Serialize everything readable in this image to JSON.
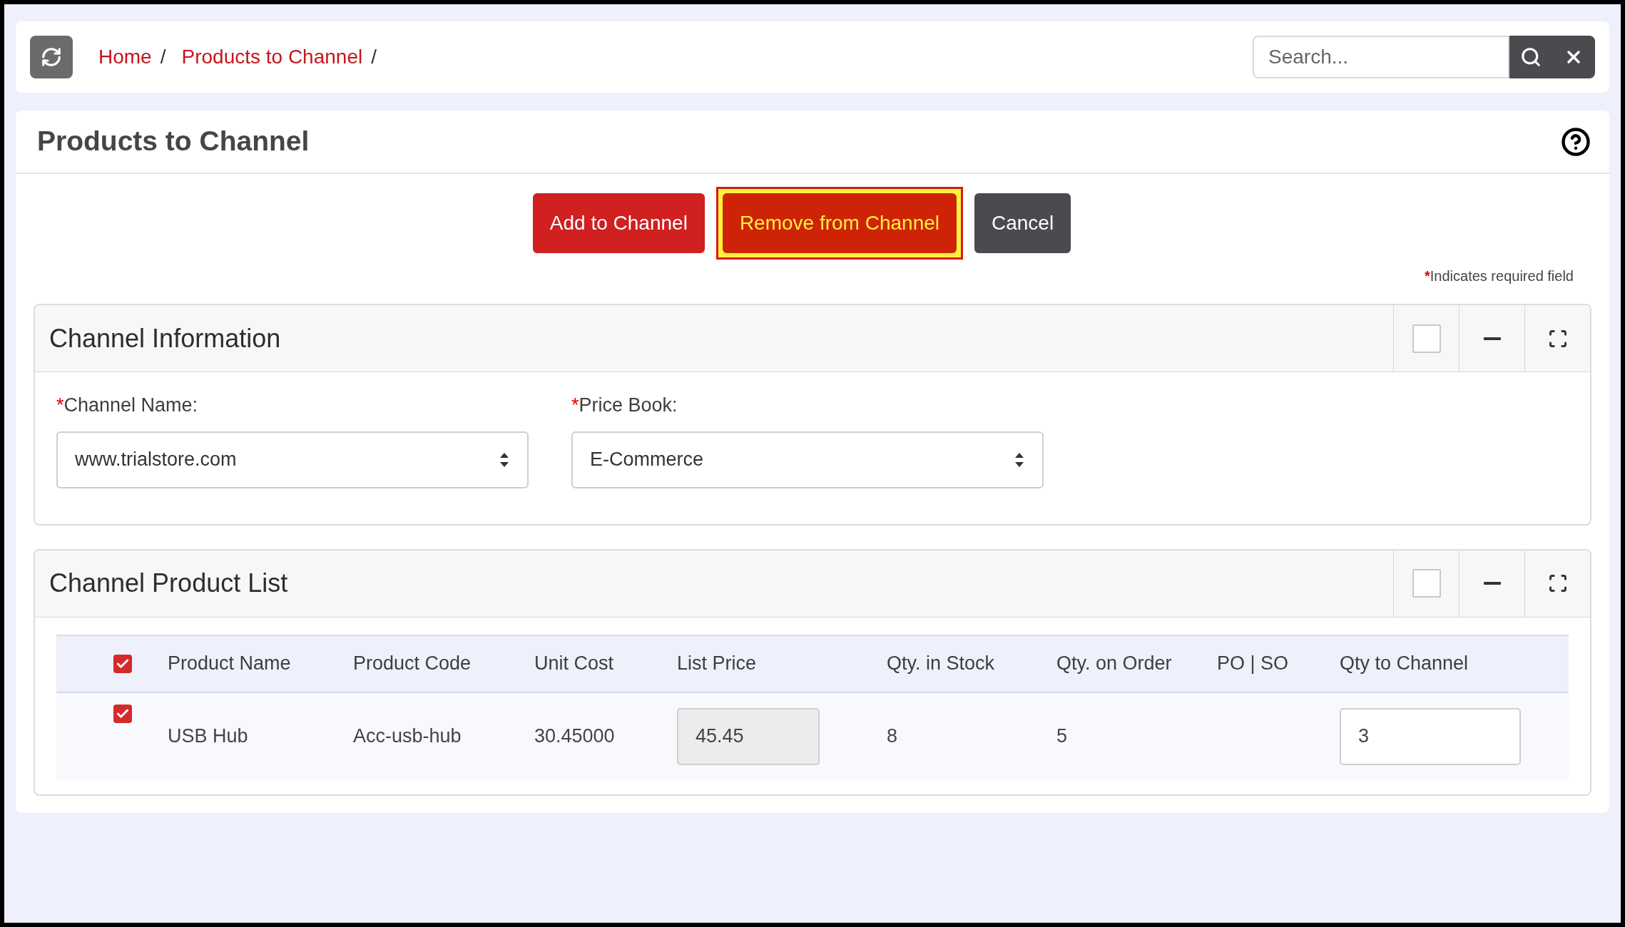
{
  "breadcrumb": [
    {
      "label": "Home"
    },
    {
      "label": "Products to Channel"
    }
  ],
  "breadcrumb_separator": "/",
  "search": {
    "placeholder": "Search..."
  },
  "page": {
    "title": "Products to Channel"
  },
  "actions": [
    {
      "label": "Add to Channel",
      "kind": "primary",
      "highlighted": false
    },
    {
      "label": "Remove from Channel",
      "kind": "primary",
      "highlighted": true
    },
    {
      "label": "Cancel",
      "kind": "secondary",
      "highlighted": false
    }
  ],
  "required_note": {
    "mark": "*",
    "text": "Indicates required field"
  },
  "channel_information": {
    "title": "Channel Information",
    "fields": [
      {
        "mark": "*",
        "label": "Channel Name:",
        "value": "www.trialstore.com"
      },
      {
        "mark": "*",
        "label": "Price Book:",
        "value": "E-Commerce"
      }
    ]
  },
  "channel_product_list": {
    "title": "Channel Product List",
    "all_checked": true,
    "columns": [
      "Product Name",
      "Product Code",
      "Unit Cost",
      "List Price",
      "Qty. in Stock",
      "Qty. on Order",
      "PO | SO",
      "Qty to Channel"
    ],
    "rows": [
      {
        "checked": true,
        "cells": [
          {
            "kind": "text",
            "value": "USB Hub"
          },
          {
            "kind": "text",
            "value": "Acc-usb-hub"
          },
          {
            "kind": "text",
            "value": "30.45000"
          },
          {
            "kind": "readonly",
            "value": "45.45"
          },
          {
            "kind": "text",
            "value": "8"
          },
          {
            "kind": "text",
            "value": "5"
          },
          {
            "kind": "empty"
          },
          {
            "kind": "input",
            "value": "3"
          }
        ]
      }
    ]
  }
}
